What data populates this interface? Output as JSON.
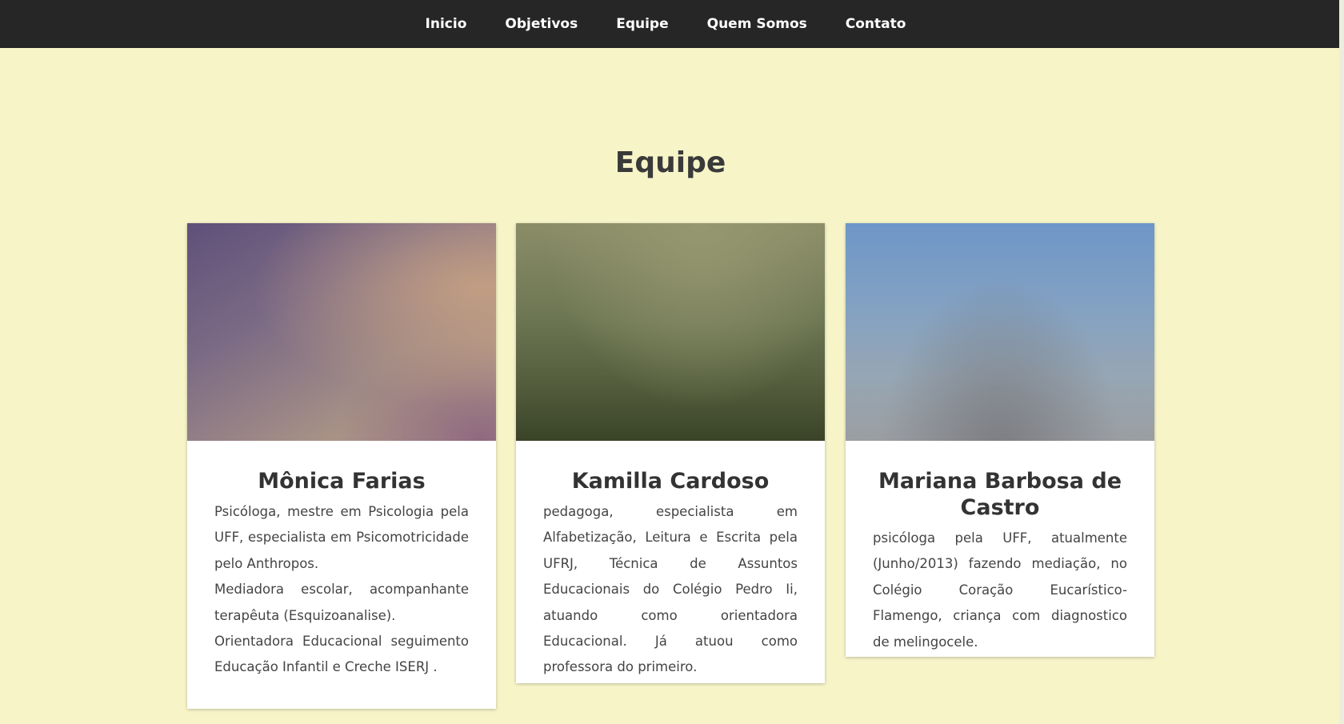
{
  "nav": {
    "items": [
      {
        "label": "Inicio"
      },
      {
        "label": "Objetivos"
      },
      {
        "label": "Equipe"
      },
      {
        "label": "Quem Somos"
      },
      {
        "label": "Contato"
      }
    ]
  },
  "section": {
    "title": "Equipe"
  },
  "team": [
    {
      "name": "Mônica Farias",
      "paragraphs": [
        "Psicóloga, mestre em Psicologia pela UFF, especialista em Psicomotricidade pelo Anthropos.",
        "Mediadora escolar, acompanhante terapêuta (Esquizoanalise).",
        "Orientadora Educacional seguimento Educação Infantil e Creche ISERJ ."
      ]
    },
    {
      "name": "Kamilla Cardoso",
      "paragraphs": [
        "pedagoga, especialista em Alfabetização, Leitura e Escrita pela UFRJ, Técnica de Assuntos Educacionais do Colégio Pedro Ii, atuando como orientadora Educacional. Já atuou como professora do primeiro."
      ]
    },
    {
      "name": "Mariana Barbosa de Castro",
      "paragraphs": [
        "psicóloga pela UFF, atualmente (Junho/2013) fazendo mediação, no Colégio Coração Eucarístico- Flamengo, criança com diagnostico de melingocele."
      ]
    }
  ],
  "colors": {
    "nav_background": "#262626",
    "page_background": "#f7f5c8",
    "card_background": "#ffffff"
  }
}
